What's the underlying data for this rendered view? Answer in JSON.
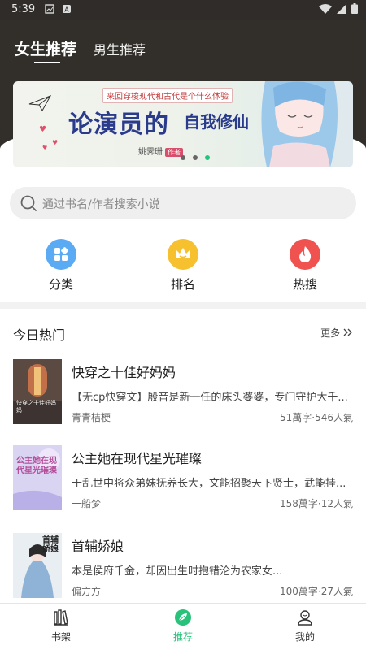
{
  "status": {
    "time": "5:39"
  },
  "header": {
    "tabs": [
      {
        "label": "女生推荐",
        "active": true
      },
      {
        "label": "男生推荐",
        "active": false
      }
    ]
  },
  "banner": {
    "subtitle": "来回穿梭现代和古代是个什么体验",
    "title_main": "论演员的",
    "title_side": "自我修仙",
    "author": "姚霁珊",
    "author_tag": "作者",
    "dots": 3,
    "active_dot": 2
  },
  "search": {
    "placeholder": "通过书名/作者搜索小说"
  },
  "quick_links": [
    {
      "label": "分类",
      "icon": "category-icon",
      "color": "#5aaaf4"
    },
    {
      "label": "排名",
      "icon": "crown-icon",
      "color": "#f6c02f"
    },
    {
      "label": "热搜",
      "icon": "flame-icon",
      "color": "#f0524f"
    }
  ],
  "section": {
    "title": "今日热门",
    "more": "更多"
  },
  "books": [
    {
      "title": "快穿之十佳好妈妈",
      "desc": "【无cp快穿文】殷音是新一任的床头婆婆，专门守护大千...",
      "author": "青青桔梗",
      "stats": "51萬字·546人氣",
      "cover_text": "快穿之十佳好妈妈"
    },
    {
      "title": "公主她在现代星光璀璨",
      "desc": "于乱世中将众弟妹抚养长大，文能招聚天下贤士，武能挂...",
      "author": "一船梦",
      "stats": "158萬字·12人氣",
      "cover_text": "公主她在现代星光璀璨"
    },
    {
      "title": "首辅娇娘",
      "desc": "本是侯府千金，却因出生时抱错沦为农家女...",
      "author": "偏方方",
      "stats": "100萬字·27人氣",
      "cover_text": "首辅娇娘"
    }
  ],
  "tabbar": [
    {
      "label": "书架",
      "icon": "bookshelf-icon",
      "active": false
    },
    {
      "label": "推荐",
      "icon": "recommend-leaf-icon",
      "active": true
    },
    {
      "label": "我的",
      "icon": "profile-icon",
      "active": false
    }
  ],
  "colors": {
    "accent": "#28c27a",
    "header_bg": "#322f2b"
  }
}
